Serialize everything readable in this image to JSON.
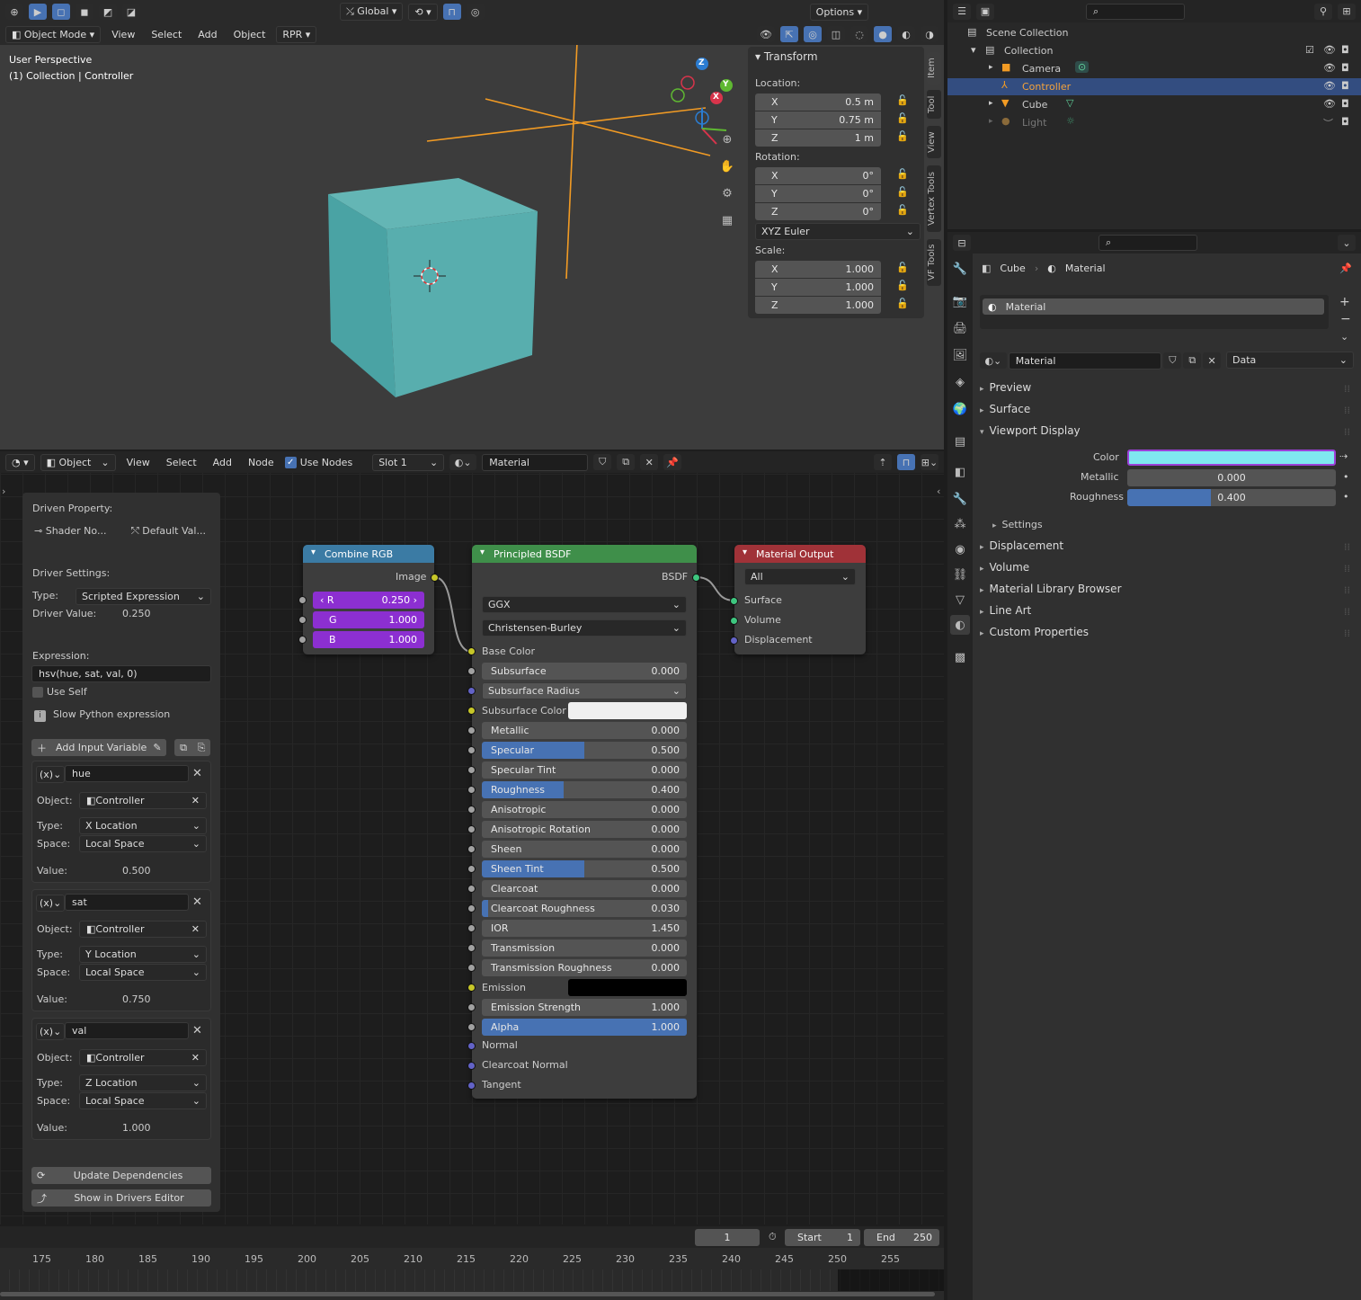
{
  "viewport": {
    "mode": "Object Mode",
    "menus": [
      "View",
      "Select",
      "Add",
      "Object",
      "RPR"
    ],
    "orientation": "Global",
    "options_label": "Options",
    "overlay_title": "User Perspective",
    "overlay_subtitle": "(1) Collection | Controller",
    "gizmo": {
      "x": "X",
      "y": "Y",
      "z": "Z"
    }
  },
  "n_panel": {
    "tabs": [
      "Item",
      "Tool",
      "View",
      "Vertex Tools",
      "VF Tools"
    ],
    "transform_label": "Transform",
    "location_label": "Location:",
    "location": [
      {
        "axis": "X",
        "value": "0.5 m"
      },
      {
        "axis": "Y",
        "value": "0.75 m"
      },
      {
        "axis": "Z",
        "value": "1 m"
      }
    ],
    "rotation_label": "Rotation:",
    "rotation": [
      {
        "axis": "X",
        "value": "0°"
      },
      {
        "axis": "Y",
        "value": "0°"
      },
      {
        "axis": "Z",
        "value": "0°"
      }
    ],
    "rotation_mode": "XYZ Euler",
    "scale_label": "Scale:",
    "scale": [
      {
        "axis": "X",
        "value": "1.000"
      },
      {
        "axis": "Y",
        "value": "1.000"
      },
      {
        "axis": "Z",
        "value": "1.000"
      }
    ]
  },
  "outliner": {
    "scene_collection": "Scene Collection",
    "collection": "Collection",
    "items": [
      "Camera",
      "Controller",
      "Cube",
      "Light"
    ]
  },
  "properties": {
    "breadcrumb_object": "Cube",
    "breadcrumb_material": "Material",
    "slot_name": "Material",
    "material_name": "Material",
    "link_mode": "Data",
    "sections": [
      "Preview",
      "Surface",
      "Viewport Display"
    ],
    "color_label": "Color",
    "metallic_label": "Metallic",
    "metallic_value": "0.000",
    "roughness_label": "Roughness",
    "roughness_value": "0.400",
    "roughness_fraction": 0.4,
    "settings_label": "Settings",
    "more_sections": [
      "Displacement",
      "Volume",
      "Material Library Browser",
      "Line Art",
      "Custom Properties"
    ],
    "viewport_color": "#7fe8f0"
  },
  "node_editor": {
    "editor_type": "Object",
    "menus": [
      "View",
      "Select",
      "Add",
      "Node"
    ],
    "use_nodes_label": "Use Nodes",
    "slot": "Slot 1",
    "material": "Material"
  },
  "driver": {
    "driven_property_label": "Driven Property:",
    "driven_a": "Shader No...",
    "driven_b": "Default Val...",
    "driver_settings_label": "Driver Settings:",
    "type_label": "Type:",
    "type_value": "Scripted Expression",
    "driver_value_label": "Driver Value:",
    "driver_value": "0.250",
    "expression_label": "Expression:",
    "expression": "hsv(hue, sat, val, 0)",
    "use_self": "Use Self",
    "slow_python": "Slow Python expression",
    "add_input_variable": "Add Input Variable",
    "variables": [
      {
        "name": "hue",
        "object": "Controller",
        "type": "X Location",
        "space": "Local Space",
        "value": "0.500"
      },
      {
        "name": "sat",
        "object": "Controller",
        "type": "Y Location",
        "space": "Local Space",
        "value": "0.750"
      },
      {
        "name": "val",
        "object": "Controller",
        "type": "Z Location",
        "space": "Local Space",
        "value": "1.000"
      }
    ],
    "object_label": "Object:",
    "var_type_label": "Type:",
    "space_label": "Space:",
    "value_label": "Value:",
    "update_deps": "Update Dependencies",
    "show_in_drivers": "Show in Drivers Editor"
  },
  "combine_rgb": {
    "title": "Combine RGB",
    "output": "Image",
    "r_label": "R",
    "r_value": "0.250",
    "g_label": "G",
    "g_value": "1.000",
    "b_label": "B",
    "b_value": "1.000"
  },
  "bsdf": {
    "title": "Principled BSDF",
    "output": "BSDF",
    "distribution": "GGX",
    "subsurface_method": "Christensen-Burley",
    "base_color": "Base Color",
    "rows": [
      {
        "label": "Subsurface",
        "value": "0.000",
        "fill": 0
      },
      {
        "label": "Subsurface Radius",
        "value": "",
        "fill": -1
      },
      {
        "label": "Subsurface Color",
        "value": "",
        "fill": -2
      },
      {
        "label": "Metallic",
        "value": "0.000",
        "fill": 0
      },
      {
        "label": "Specular",
        "value": "0.500",
        "fill": 0.5
      },
      {
        "label": "Specular Tint",
        "value": "0.000",
        "fill": 0
      },
      {
        "label": "Roughness",
        "value": "0.400",
        "fill": 0.4
      },
      {
        "label": "Anisotropic",
        "value": "0.000",
        "fill": 0
      },
      {
        "label": "Anisotropic Rotation",
        "value": "0.000",
        "fill": 0
      },
      {
        "label": "Sheen",
        "value": "0.000",
        "fill": 0
      },
      {
        "label": "Sheen Tint",
        "value": "0.500",
        "fill": 0.5
      },
      {
        "label": "Clearcoat",
        "value": "0.000",
        "fill": 0
      },
      {
        "label": "Clearcoat Roughness",
        "value": "0.030",
        "fill": 0.03
      },
      {
        "label": "IOR",
        "value": "1.450",
        "fill": 0
      },
      {
        "label": "Transmission",
        "value": "0.000",
        "fill": 0
      },
      {
        "label": "Transmission Roughness",
        "value": "0.000",
        "fill": 0
      },
      {
        "label": "Emission",
        "value": "",
        "fill": -3
      },
      {
        "label": "Emission Strength",
        "value": "1.000",
        "fill": 0
      },
      {
        "label": "Alpha",
        "value": "1.000",
        "fill": 1
      }
    ],
    "vectors": [
      "Normal",
      "Clearcoat Normal",
      "Tangent"
    ]
  },
  "material_output": {
    "title": "Material Output",
    "target": "All",
    "inputs": [
      "Surface",
      "Volume",
      "Displacement"
    ]
  },
  "timeline": {
    "current_frame": "1",
    "start_label": "Start",
    "start": "1",
    "end_label": "End",
    "end": "250",
    "ticks": [
      "175",
      "180",
      "185",
      "190",
      "195",
      "200",
      "205",
      "210",
      "215",
      "220",
      "225",
      "230",
      "235",
      "240",
      "245",
      "250",
      "255"
    ]
  }
}
